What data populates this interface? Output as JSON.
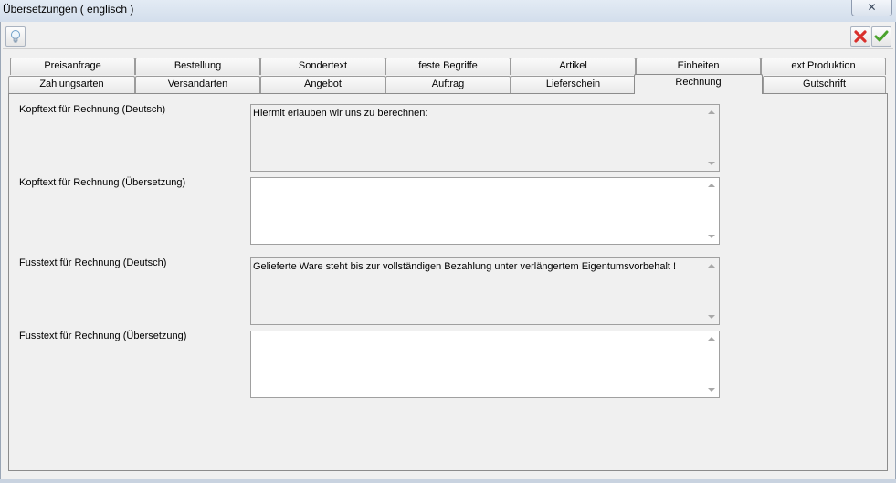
{
  "window": {
    "title": "Übersetzungen ( englisch )",
    "close_label": "✕"
  },
  "toolbar": {
    "hint_icon": "lightbulb-icon",
    "cancel_icon": "red-x-icon",
    "confirm_icon": "green-check-icon"
  },
  "tabs": {
    "row_top": [
      {
        "label": "Preisanfrage"
      },
      {
        "label": "Bestellung"
      },
      {
        "label": "Sondertext"
      },
      {
        "label": "feste Begriffe"
      },
      {
        "label": "Artikel"
      },
      {
        "label": "Einheiten"
      },
      {
        "label": "ext.Produktion"
      }
    ],
    "row_bottom": [
      {
        "label": "Zahlungsarten"
      },
      {
        "label": "Versandarten"
      },
      {
        "label": "Angebot"
      },
      {
        "label": "Auftrag"
      },
      {
        "label": "Lieferschein"
      },
      {
        "label": "Rechnung",
        "active": true
      },
      {
        "label": "Gutschrift"
      }
    ]
  },
  "fields": [
    {
      "label": "Kopftext für Rechnung (Deutsch)",
      "value": "Hiermit erlauben wir uns zu berechnen:",
      "editable": false
    },
    {
      "label": "Kopftext für Rechnung (Übersetzung)",
      "value": "",
      "editable": true
    },
    {
      "label": "Fusstext für Rechnung (Deutsch)",
      "value": "Gelieferte Ware steht bis zur vollständigen Bezahlung unter verlängertem Eigentumsvorbehalt !",
      "editable": false
    },
    {
      "label": "Fusstext für Rechnung (Übersetzung)",
      "value": "",
      "editable": true
    }
  ],
  "colors": {
    "cancel_red": "#d9302c",
    "confirm_green": "#4aa32c"
  }
}
